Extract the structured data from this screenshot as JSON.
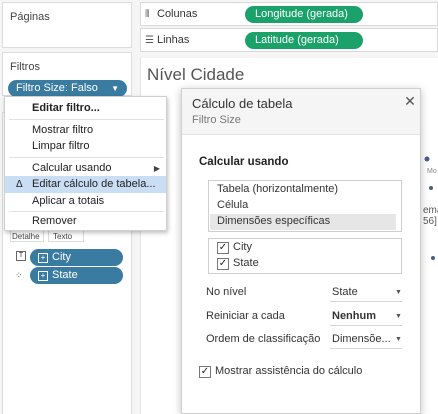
{
  "left_panel": {
    "pages_title": "Páginas",
    "filters_title": "Filtros",
    "filter_pill": "Filtro Size: Falso",
    "marks_label_detail": "Detalhe",
    "marks_label_partial": "Texto",
    "fields": [
      {
        "name": "City",
        "icon": "text-icon"
      },
      {
        "name": "State",
        "icon": "dots-icon"
      }
    ]
  },
  "shelves": {
    "columns_label": "Colunas",
    "columns_pill": "Longitude (gerada)",
    "rows_label": "Linhas",
    "rows_pill": "Latitude (gerada)"
  },
  "sheet": {
    "title": "Nível Cidade",
    "partial_mo": "Mo",
    "partial_rema": "ema",
    "partial_56": "56]"
  },
  "context_menu": {
    "items": [
      {
        "label": "Editar filtro..."
      },
      {
        "label": "Mostrar filtro"
      },
      {
        "label": "Limpar filtro"
      },
      {
        "label": "Calcular usando"
      },
      {
        "label": "Editar cálculo de tabela..."
      },
      {
        "label": "Aplicar a totais"
      },
      {
        "label": "Remover"
      }
    ]
  },
  "dialog": {
    "title": "Cálculo de tabela",
    "subtitle": "Filtro Size",
    "compute_using_label": "Calcular usando",
    "options": [
      "Tabela (horizontalmente)",
      "Célula",
      "Dimensões específicas"
    ],
    "selected_option": "Dimensões específicas",
    "dimensions": [
      {
        "name": "City",
        "checked": true
      },
      {
        "name": "State",
        "checked": true
      }
    ],
    "at_level_label": "No nível",
    "at_level_value": "State",
    "restart_label": "Reiniciar a cada",
    "restart_value": "Nenhum",
    "sort_label": "Ordem de classificação",
    "sort_value": "Dimensõe...",
    "assist_label": "Mostrar assistência do cálculo",
    "assist_checked": true
  },
  "colors": {
    "green_pill": "#1ba26b",
    "blue_pill": "#3a7ba1",
    "menu_highlight": "#c9ddf4"
  }
}
